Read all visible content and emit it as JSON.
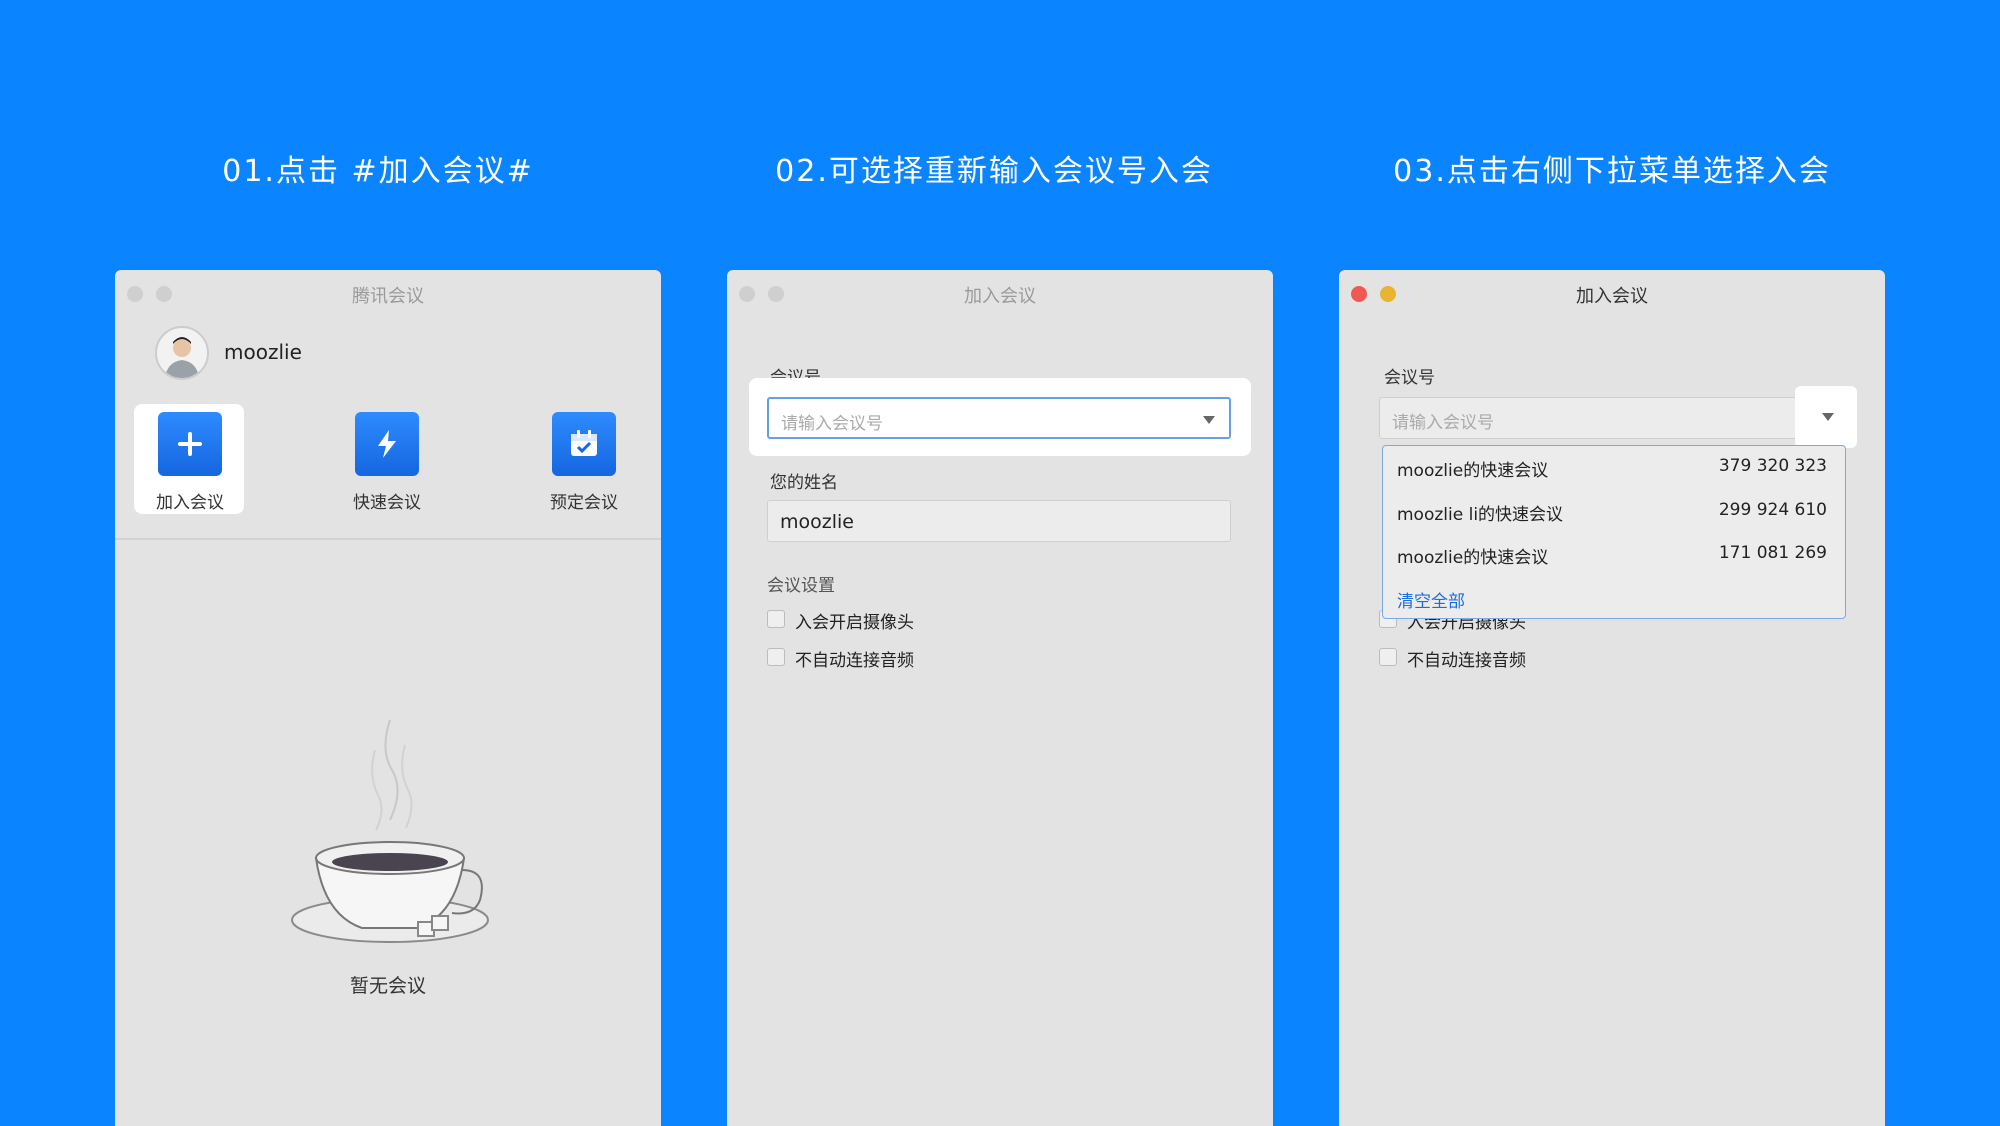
{
  "steps": [
    "01.点击 #加入会议#",
    "02.可选择重新输入会议号入会",
    "03.点击右侧下拉菜单选择入会"
  ],
  "window1": {
    "title": "腾讯会议",
    "username": "moozlie",
    "actions": [
      {
        "label": "加入会议",
        "icon": "plus-icon"
      },
      {
        "label": "快速会议",
        "icon": "lightning-icon"
      },
      {
        "label": "预定会议",
        "icon": "calendar-icon"
      }
    ],
    "empty_text": "暂无会议"
  },
  "window2": {
    "title": "加入会议",
    "meeting_id_label": "会议号",
    "meeting_id_placeholder": "请输入会议号",
    "name_label": "您的姓名",
    "name_value": "moozlie",
    "settings_label": "会议设置",
    "options": [
      "入会开启摄像头",
      "不自动连接音频"
    ]
  },
  "window3": {
    "title": "加入会议",
    "meeting_id_label": "会议号",
    "meeting_id_placeholder": "请输入会议号",
    "dropdown": [
      {
        "name": "moozlie的快速会议",
        "number": "379 320 323"
      },
      {
        "name": "moozlie li的快速会议",
        "number": "299 924 610"
      },
      {
        "name": "moozlie的快速会议",
        "number": "171 081 269"
      }
    ],
    "clear_all": "清空全部",
    "options": [
      "入会开启摄像头",
      "不自动连接音频"
    ]
  },
  "colors": {
    "background": "#0a84ff",
    "window": "#e3e3e3",
    "accent": "#1a6fe0",
    "close": "#ee5a52",
    "minimize": "#e9b432"
  }
}
